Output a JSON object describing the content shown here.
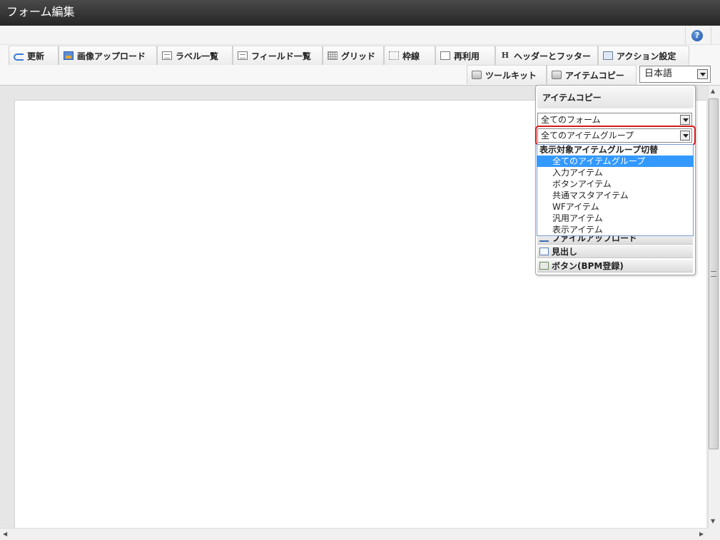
{
  "window": {
    "title": "フォーム編集"
  },
  "toolbar": {
    "row1": [
      {
        "label": "更新",
        "icon": "refresh-icon"
      },
      {
        "label": "画像アップロード",
        "icon": "image-upload-icon"
      },
      {
        "label": "ラベル一覧",
        "icon": "label-list-icon"
      },
      {
        "label": "フィールド一覧",
        "icon": "field-list-icon"
      },
      {
        "label": "グリッド",
        "icon": "grid-icon"
      },
      {
        "label": "枠線",
        "icon": "border-icon"
      },
      {
        "label": "再利用",
        "icon": "reuse-icon"
      },
      {
        "label": "ヘッダーとフッター",
        "icon": "header-footer-icon"
      },
      {
        "label": "アクション設定",
        "icon": "action-settings-icon"
      }
    ],
    "row2": [
      {
        "label": "ツールキット",
        "icon": "toolkit-icon"
      },
      {
        "label": "アイテムコピー",
        "icon": "item-copy-icon"
      }
    ],
    "language": "日本語",
    "help_icon": "help-icon",
    "help_glyph": "?"
  },
  "panel": {
    "title": "アイテムコピー",
    "form_select": "全てのフォーム",
    "group_select": "全てのアイテムグループ",
    "dropdown": {
      "group_label": "表示対象アイテムグループ切替",
      "options": [
        "全てのアイテムグループ",
        "入力アイテム",
        "ボタンアイテム",
        "共通マスタアイテム",
        "WFアイテム",
        "汎用アイテム",
        "表示アイテム"
      ],
      "selected_index": 0
    },
    "items": [
      {
        "label": "ファイルアップロード",
        "icon": "file-upload-icon"
      },
      {
        "label": "見出し",
        "icon": "heading-icon"
      },
      {
        "label": "ボタン(BPM登録)",
        "icon": "bpm-button-icon"
      }
    ]
  },
  "scrollbar": {
    "up": "▲",
    "down": "▼",
    "left": "◀",
    "right": "▶"
  }
}
